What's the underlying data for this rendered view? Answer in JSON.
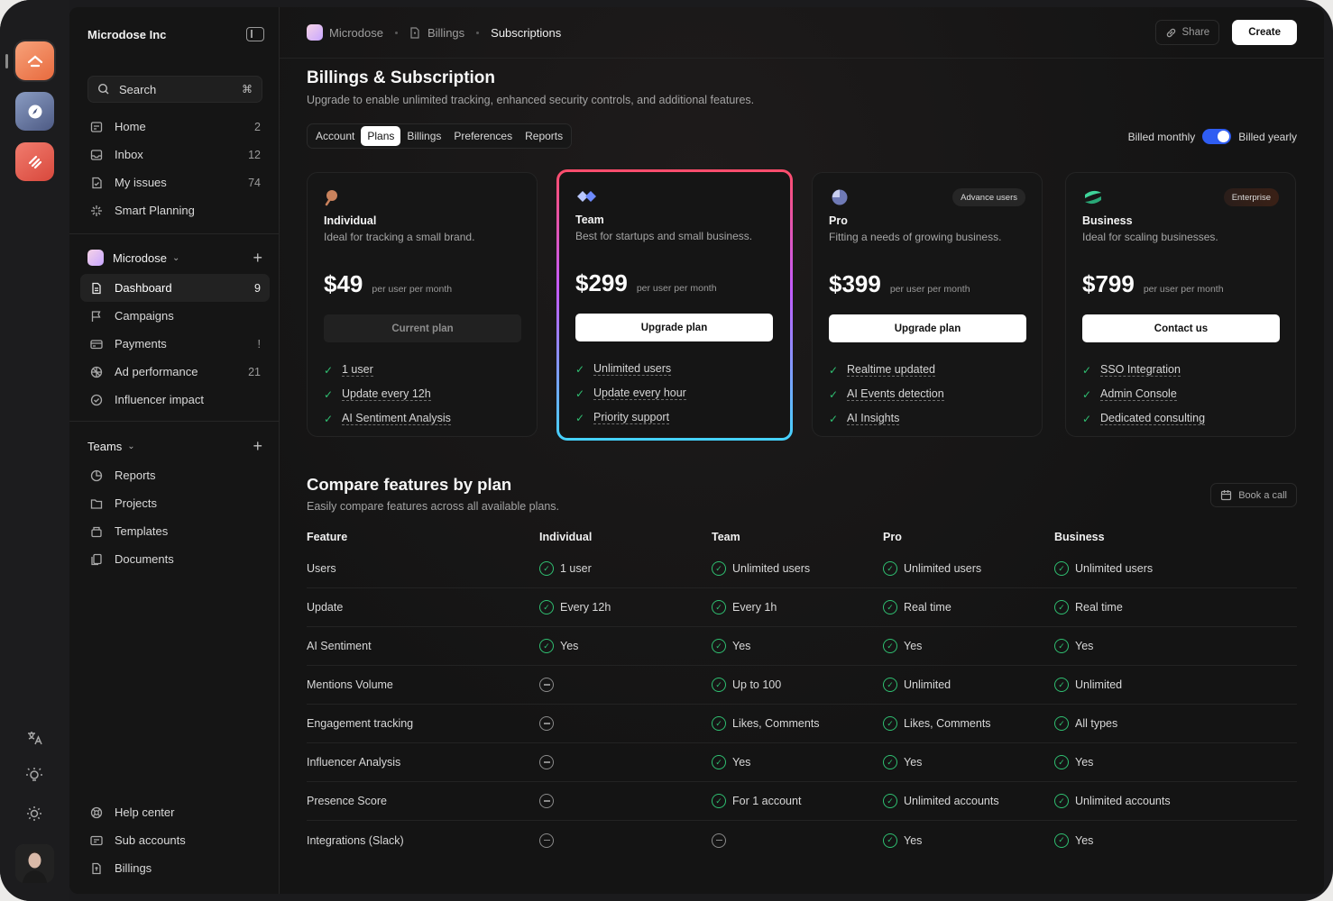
{
  "org": {
    "name": "Microdose Inc"
  },
  "search": {
    "label": "Search",
    "shortcut": "⌘"
  },
  "nav_main": [
    {
      "label": "Home",
      "count": "2",
      "icon": "home-icon"
    },
    {
      "label": "Inbox",
      "count": "12",
      "icon": "inbox-icon"
    },
    {
      "label": "My issues",
      "count": "74",
      "icon": "issues-icon"
    },
    {
      "label": "Smart Planning",
      "count": "",
      "icon": "sparkle-icon"
    }
  ],
  "workspace": {
    "name": "Microdose",
    "items": [
      {
        "label": "Dashboard",
        "count": "9",
        "icon": "dashboard-icon"
      },
      {
        "label": "Campaigns",
        "count": "",
        "icon": "flag-icon"
      },
      {
        "label": "Payments",
        "count": "!",
        "icon": "card-icon"
      },
      {
        "label": "Ad performance",
        "count": "21",
        "icon": "chart-icon"
      },
      {
        "label": "Influencer impact",
        "count": "",
        "icon": "check-circle-icon"
      }
    ]
  },
  "teams": {
    "title": "Teams",
    "items": [
      {
        "label": "Reports",
        "icon": "pie-icon"
      },
      {
        "label": "Projects",
        "icon": "folder-icon"
      },
      {
        "label": "Templates",
        "icon": "template-icon"
      },
      {
        "label": "Documents",
        "icon": "docs-icon"
      }
    ]
  },
  "footer_nav": [
    {
      "label": "Help center",
      "icon": "help-icon"
    },
    {
      "label": "Sub accounts",
      "icon": "accounts-icon"
    },
    {
      "label": "Billings",
      "icon": "billing-icon"
    }
  ],
  "breadcrumb": {
    "root": "Microdose",
    "mid": "Billings",
    "current": "Subscriptions"
  },
  "actions": {
    "share": "Share",
    "create": "Create"
  },
  "page": {
    "title": "Billings & Subscription",
    "subtitle": "Upgrade to enable unlimited tracking, enhanced security controls, and additional features."
  },
  "tabs": [
    "Account",
    "Plans",
    "Billings",
    "Preferences",
    "Reports"
  ],
  "billing": {
    "monthly": "Billed monthly",
    "yearly": "Billed yearly"
  },
  "plans": [
    {
      "name": "Individual",
      "desc": "Ideal for tracking a small brand.",
      "price": "$49",
      "per": "per user per month",
      "button": "Current plan",
      "badge": "",
      "features": [
        "1 user",
        "Update every 12h",
        "AI Sentiment Analysis"
      ]
    },
    {
      "name": "Team",
      "desc": "Best for startups and small business.",
      "price": "$299",
      "per": "per user per month",
      "button": "Upgrade plan",
      "badge": "",
      "features": [
        "Unlimited users",
        "Update every hour",
        "Priority support"
      ]
    },
    {
      "name": "Pro",
      "desc": "Fitting a needs of growing business.",
      "price": "$399",
      "per": "per user per month",
      "button": "Upgrade plan",
      "badge": "Advance users",
      "features": [
        "Realtime updated",
        "AI Events detection",
        "AI Insights"
      ]
    },
    {
      "name": "Business",
      "desc": "Ideal for scaling businesses.",
      "price": "$799",
      "per": "per user per month",
      "button": "Contact us",
      "badge": "Enterprise",
      "features": [
        "SSO Integration",
        "Admin Console",
        "Dedicated consulting"
      ]
    }
  ],
  "compare": {
    "title": "Compare features by plan",
    "subtitle": "Easily compare features across all available plans.",
    "book_call": "Book a call",
    "headers": [
      "Feature",
      "Individual",
      "Team",
      "Pro",
      "Business"
    ],
    "rows": [
      {
        "feature": "Users",
        "values": [
          "1 user",
          "Unlimited users",
          "Unlimited users",
          "Unlimited users"
        ]
      },
      {
        "feature": "Update",
        "values": [
          "Every 12h",
          "Every 1h",
          "Real time",
          "Real time"
        ]
      },
      {
        "feature": "AI Sentiment",
        "values": [
          "Yes",
          "Yes",
          "Yes",
          "Yes"
        ]
      },
      {
        "feature": "Mentions Volume",
        "values": [
          "",
          "Up to 100",
          "Unlimited",
          "Unlimited"
        ]
      },
      {
        "feature": "Engagement tracking",
        "values": [
          "",
          "Likes, Comments",
          "Likes, Comments",
          "All types"
        ]
      },
      {
        "feature": "Influencer Analysis",
        "values": [
          "",
          "Yes",
          "Yes",
          "Yes"
        ]
      },
      {
        "feature": "Presence Score",
        "values": [
          "",
          "For 1 account",
          "Unlimited accounts",
          "Unlimited accounts"
        ]
      },
      {
        "feature": "Integrations (Slack)",
        "values": [
          "",
          "",
          "Yes",
          "Yes"
        ]
      }
    ]
  },
  "colors": {
    "accent": "#2f5df2",
    "check": "#2fbf71",
    "featured_gradient_top": "#ff4d6a",
    "featured_gradient_bottom": "#44d3ff"
  }
}
